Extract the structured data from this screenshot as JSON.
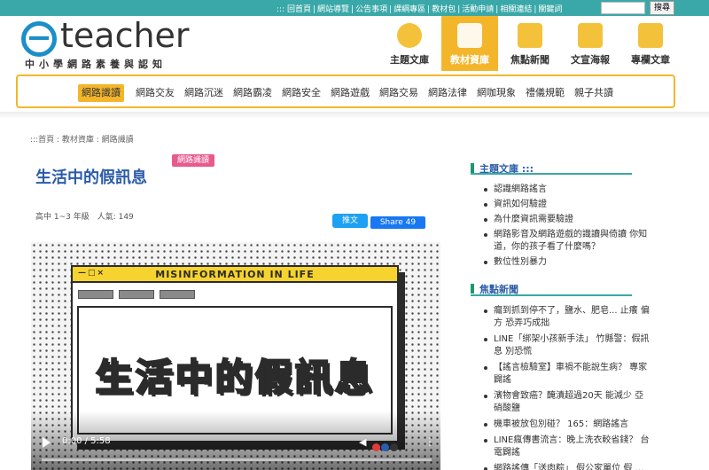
{
  "topbar": {
    "links": [
      "::: 回首頁",
      "網站導覽",
      "公告事項",
      "課綱專區",
      "教材包",
      "活動申請",
      "相關連結",
      "關鍵詞"
    ],
    "search_button": "搜尋"
  },
  "logo": {
    "brand": "teacher",
    "subtitle": "中小學網路素養與認知"
  },
  "main_nav": [
    {
      "label": "主題文庫"
    },
    {
      "label": "教材資庫"
    },
    {
      "label": "焦點新聞"
    },
    {
      "label": "文宣海報"
    },
    {
      "label": "專欄文章"
    }
  ],
  "sub_nav": [
    "網路識讀",
    "網路交友",
    "網路沉迷",
    "網路霸凌",
    "網路安全",
    "網路遊戲",
    "網路交易",
    "網路法律",
    "網咖現象",
    "禮儀規範",
    "親子共讀"
  ],
  "breadcrumb": ":::首頁 : 教材資庫 : 網路識讀",
  "article": {
    "title": "生活中的假訊息",
    "tag": "網路識讀",
    "meta": "高中 1~3 年級　人氣: 149",
    "tweet_label": "推文",
    "share_label": "Share 49"
  },
  "video": {
    "window_title": "MISINFORMATION IN LIFE",
    "window_controls": "—□×",
    "headline": "生活中的假訊息",
    "time": "0:00 / 5:58"
  },
  "sidebar": {
    "topic_heading": "主題文庫 :::",
    "topic_items": [
      "認識網路謠言",
      "資訊如何驗證",
      "為什麼資訊需要驗證",
      "網路影音及網路遊戲的識讀與倚讀 你知道，你的孩子看了什麼嗎？",
      "數位性別暴力"
    ],
    "news_heading": "焦點新聞",
    "news_items": [
      "癟到抓到停不了，鹽水、肥皂... 止癢 偏方 恐弄巧成拙",
      "LINE「綁架小孩新手法」 竹縣警：假訊息 別恐慌",
      "【謠言檢驗室】車禍不能說生病？ 專家闢謠",
      "濱物會致癌？醃漬超過20天 能減少 亞硝酸鹽",
      "機車被放包別碰？ 165：網路謠言",
      "LINE瘋傳書流言：晚上洗衣較省錢？ 台電闢謠",
      "網路謠傳「送肉粽」 假公家單位 假 …"
    ]
  }
}
